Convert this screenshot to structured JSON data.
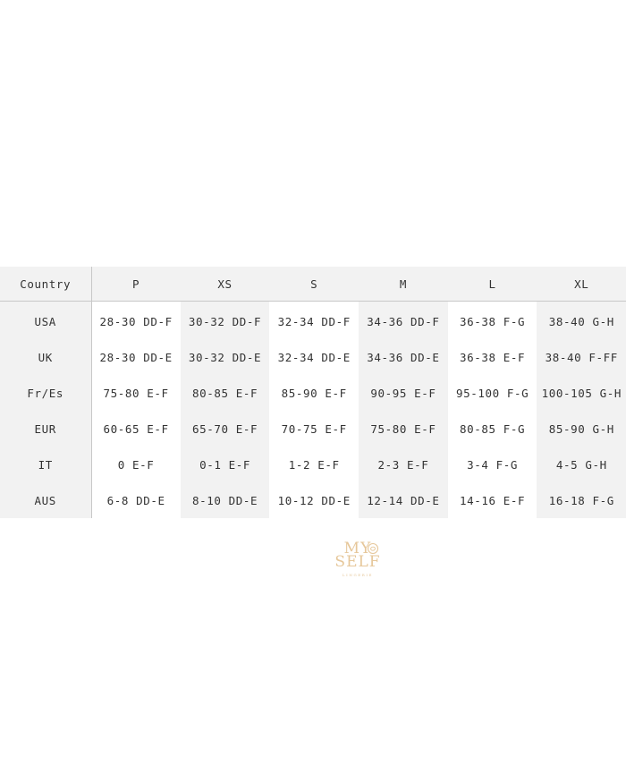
{
  "size_chart": {
    "header": [
      "Country",
      "P",
      "XS",
      "S",
      "M",
      "L",
      "XL"
    ],
    "rows": [
      [
        "USA",
        "28-30 DD-F",
        "30-32 DD-F",
        "32-34 DD-F",
        "34-36 DD-F",
        "36-38 F-G",
        "38-40 G-H"
      ],
      [
        "UK",
        "28-30 DD-E",
        "30-32 DD-E",
        "32-34 DD-E",
        "34-36 DD-E",
        "36-38 E-F",
        "38-40 F-FF"
      ],
      [
        "Fr/Es",
        "75-80 E-F",
        "80-85 E-F",
        "85-90 E-F",
        "90-95 E-F",
        "95-100 F-G",
        "100-105 G-H"
      ],
      [
        "EUR",
        "60-65 E-F",
        "65-70 E-F",
        "70-75 E-F",
        "75-80 E-F",
        "80-85 F-G",
        "85-90 G-H"
      ],
      [
        "IT",
        "0 E-F",
        "0-1 E-F",
        "1-2 E-F",
        "2-3 E-F",
        "3-4 F-G",
        "4-5 G-H"
      ],
      [
        "AUS",
        "6-8 DD-E",
        "8-10 DD-E",
        "10-12 DD-E",
        "12-14 DD-E",
        "14-16 E-F",
        "16-18 F-G"
      ]
    ]
  },
  "logo": {
    "line1": "MY",
    "line2": "SELF",
    "line3": "LINGERIE",
    "icon": "rose-icon",
    "color": "#e6c79a"
  },
  "colors": {
    "shade": "#f2f2f2",
    "border": "#c8c8c8",
    "text": "#333333"
  }
}
